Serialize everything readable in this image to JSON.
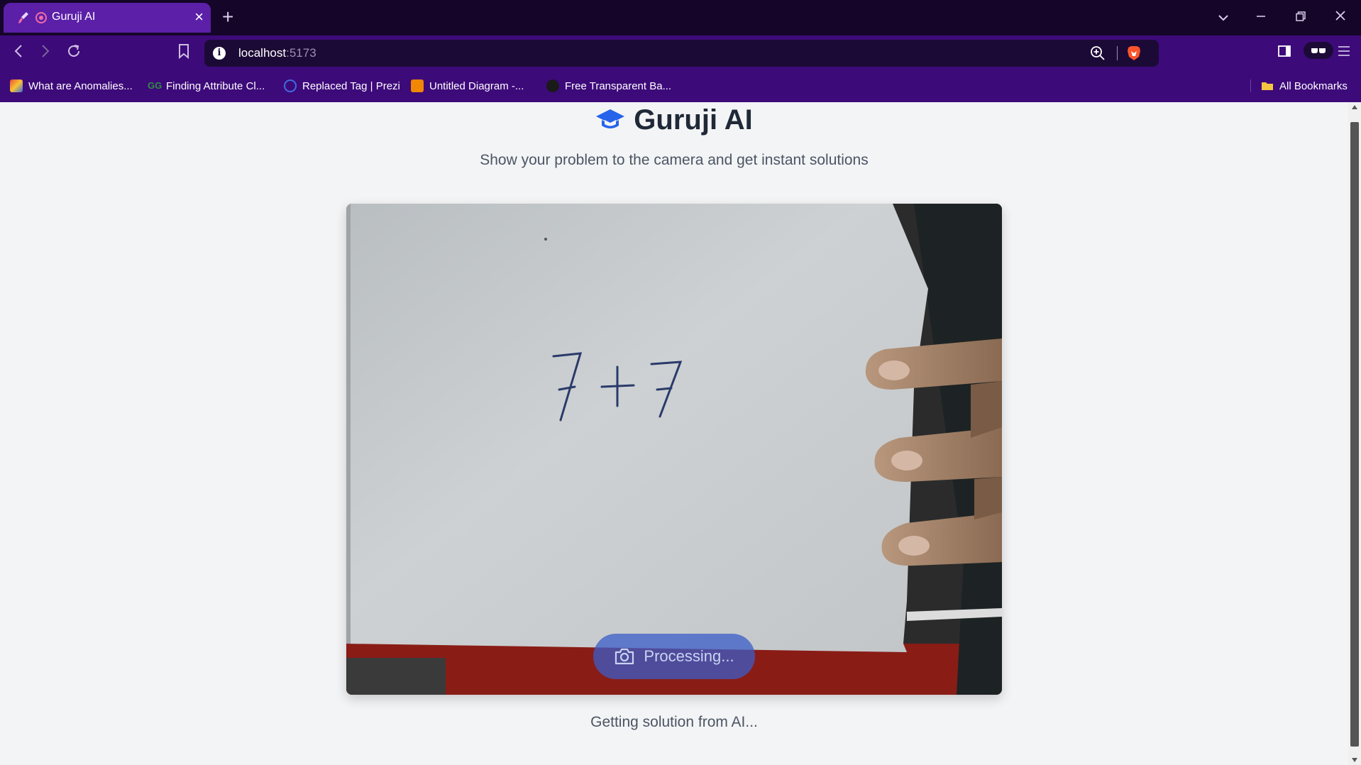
{
  "browser": {
    "tab": {
      "title": "Guruji AI"
    },
    "address": {
      "host": "localhost",
      "port": ":5173"
    },
    "bookmarks": [
      {
        "label": "What are Anomalies...",
        "color": "#e84c3d"
      },
      {
        "label": "Finding Attribute Cl...",
        "color": "#2f8d46"
      },
      {
        "label": "Replaced Tag | Prezi",
        "color": "#3d6de0"
      },
      {
        "label": "Untitled Diagram -...",
        "color": "#f08705"
      },
      {
        "label": "Free Transparent Ba...",
        "color": "#1a1a1a"
      }
    ],
    "all_bookmarks_label": "All Bookmarks"
  },
  "app": {
    "title": "Guruji AI",
    "subtitle": "Show your problem to the camera and get instant solutions",
    "camera": {
      "handwritten_problem": "7+7",
      "capture_button_label": "Processing..."
    },
    "status": "Getting solution from AI..."
  },
  "colors": {
    "accent": "#2563eb",
    "tab_active": "#5b1fa8",
    "chrome_dark": "#150529",
    "chrome_nav": "#3d0a7a"
  }
}
